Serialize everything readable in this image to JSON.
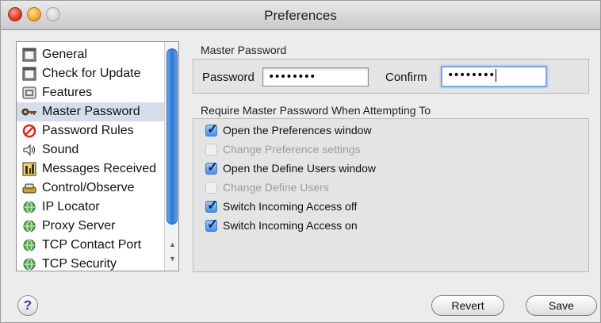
{
  "window": {
    "title": "Preferences"
  },
  "sidebar": {
    "items": [
      {
        "label": "General",
        "icon": "general-window-icon"
      },
      {
        "label": "Check for Update",
        "icon": "update-window-icon"
      },
      {
        "label": "Features",
        "icon": "features-icon"
      },
      {
        "label": "Master Password",
        "icon": "key-icon",
        "selected": true
      },
      {
        "label": "Password Rules",
        "icon": "prohibited-icon"
      },
      {
        "label": "Sound",
        "icon": "speaker-icon"
      },
      {
        "label": "Messages Received",
        "icon": "messages-icon"
      },
      {
        "label": "Control/Observe",
        "icon": "control-icon"
      },
      {
        "label": "IP Locator",
        "icon": "globe-icon"
      },
      {
        "label": "Proxy Server",
        "icon": "globe-icon"
      },
      {
        "label": "TCP Contact Port",
        "icon": "globe-icon"
      },
      {
        "label": "TCP Security",
        "icon": "globe-icon"
      }
    ]
  },
  "master_password": {
    "section_label": "Master Password",
    "password_label": "Password",
    "password_value": "••••••••",
    "confirm_label": "Confirm",
    "confirm_value": "••••••••"
  },
  "require": {
    "section_label": "Require Master Password When Attempting To",
    "options": [
      {
        "label": "Open the Preferences window",
        "checked": true,
        "enabled": true
      },
      {
        "label": "Change Preference settings",
        "checked": false,
        "enabled": false
      },
      {
        "label": "Open the Define Users window",
        "checked": true,
        "enabled": true
      },
      {
        "label": "Change Define Users",
        "checked": false,
        "enabled": false
      },
      {
        "label": "Switch Incoming Access off",
        "checked": true,
        "enabled": true
      },
      {
        "label": "Switch Incoming Access on",
        "checked": true,
        "enabled": true
      }
    ]
  },
  "footer": {
    "help_label": "?",
    "revert_label": "Revert",
    "save_label": "Save"
  },
  "colors": {
    "selection": "#d5dcec",
    "scroll_thumb": "#2d78d8",
    "focus_ring": "#79a8e4"
  }
}
